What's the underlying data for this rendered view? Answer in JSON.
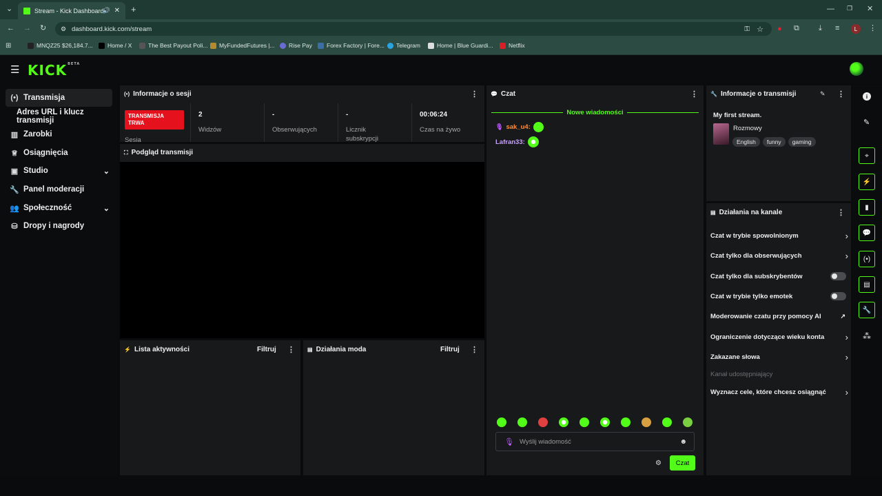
{
  "browser": {
    "tab_title": "Stream - Kick Dashboard",
    "url": "dashboard.kick.com/stream",
    "bookmarks": [
      "MNQZ25 $26,184.7...",
      "Home / X",
      "The Best Payout Poli...",
      "MyFundedFutures |...",
      "Rise Pay",
      "Forex Factory | Fore...",
      "Telegram",
      "Home | Blue Guardi...",
      "Netflix"
    ],
    "profile_initial": "L"
  },
  "app": {
    "logo": "KICK",
    "logo_badge": "BETA",
    "accent": "#53fc18"
  },
  "sidebar": {
    "items": [
      {
        "label": "Transmisja",
        "icon": "broadcast-icon"
      },
      {
        "label": "Adres URL i klucz transmisji",
        "icon": ""
      },
      {
        "label": "Zarobki",
        "icon": "chart-icon"
      },
      {
        "label": "Osiągnięcia",
        "icon": "trophy-icon"
      },
      {
        "label": "Studio",
        "icon": "studio-icon"
      },
      {
        "label": "Panel moderacji",
        "icon": "wrench-icon"
      },
      {
        "label": "Społeczność",
        "icon": "community-icon"
      },
      {
        "label": "Dropy i nagrody",
        "icon": "gift-icon"
      }
    ]
  },
  "session": {
    "title": "Informacje o sesji",
    "live_badge": "TRANSMISJA TRWA",
    "session_label": "Sesja",
    "viewers_value": "2",
    "viewers_label": "Widzów",
    "followers_value": "-",
    "followers_label": "Obserwujących",
    "subs_value": "-",
    "subs_label": "Licznik subskrypcji",
    "live_time_value": "00:06:24",
    "live_time_label": "Czas na żywo"
  },
  "preview": {
    "title": "Podgląd transmisji"
  },
  "activity": {
    "title": "Lista aktywności",
    "filter": "Filtruj"
  },
  "modactions": {
    "title": "Działania moda",
    "filter": "Filtruj"
  },
  "chat": {
    "title": "Czat",
    "new_messages": "Nowe wiadomości",
    "messages": [
      {
        "user": "sak_u4:",
        "color": "#ff8c38"
      },
      {
        "user": "Lafran33:",
        "color": "#c7a1ff"
      }
    ],
    "input_placeholder": "Wyślij wiadomość",
    "send_label": "Czat"
  },
  "stream_info": {
    "title": "Informacje o transmisji",
    "stream_title": "My first stream.",
    "category": "Rozmowy",
    "tags": [
      "English",
      "funny",
      "gaming"
    ]
  },
  "channel_actions": {
    "title": "Działania na kanale",
    "slow_mode": "Czat w trybie spowolnionym",
    "followers_only": "Czat tylko dla obserwujących",
    "subs_only": "Czat tylko dla subskrybentów",
    "emote_only": "Czat w trybie tylko emotek",
    "ai_moderation": "Moderowanie czatu przy pomocy AI",
    "age_restriction": "Ograniczenie dotyczące wieku konta",
    "banned_words": "Zakazane słowa",
    "sharing_channel": "Kanał udostępniający",
    "goals": "Wyznacz cele, które chcesz osiągnąć"
  }
}
